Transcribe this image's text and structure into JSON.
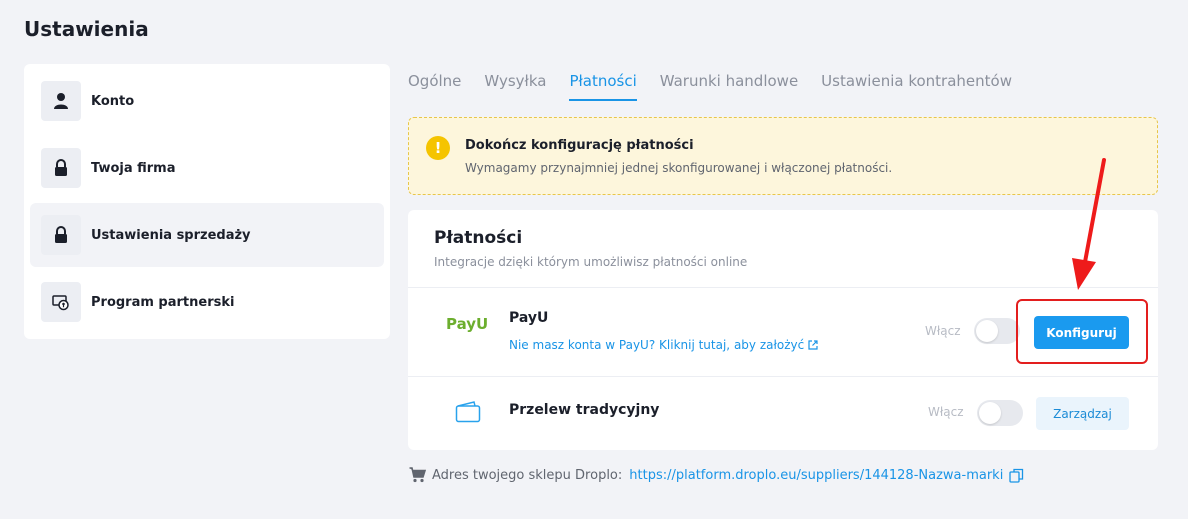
{
  "page": {
    "title": "Ustawienia"
  },
  "sidebar": {
    "items": [
      {
        "label": "Konto",
        "icon": "user-icon"
      },
      {
        "label": "Twoja firma",
        "icon": "lock-icon"
      },
      {
        "label": "Ustawienia sprzedaży",
        "icon": "lock-icon"
      },
      {
        "label": "Program partnerski",
        "icon": "partner-money-icon"
      }
    ]
  },
  "tabs": [
    {
      "label": "Ogólne"
    },
    {
      "label": "Wysyłka"
    },
    {
      "label": "Płatności"
    },
    {
      "label": "Warunki handlowe"
    },
    {
      "label": "Ustawienia kontrahentów"
    }
  ],
  "warning": {
    "icon": "!",
    "title": "Dokończ konfigurację płatności",
    "text": "Wymagamy przynajmniej jednej skonfigurowanej i włączonej płatności."
  },
  "payments": {
    "title": "Płatności",
    "subtitle": "Integracje dzięki którym umożliwisz płatności online",
    "payu": {
      "logo": "PayU",
      "name": "PayU",
      "note": "Nie masz konta w PayU?",
      "link": "Kliknij tutaj, aby założyć",
      "toggle_label": "Włącz",
      "button": "Konfiguruj"
    },
    "przelew": {
      "name": "Przelew tradycyjny",
      "toggle_label": "Włącz",
      "button": "Zarządzaj"
    }
  },
  "footer": {
    "label": "Adres twojego sklepu Droplo:",
    "url": "https://platform.droplo.eu/suppliers/144128-Nazwa-marki"
  },
  "colors": {
    "accent": "#1994e6",
    "warning_bg": "#fdf6dc",
    "annotation_red": "#e31e1e"
  }
}
